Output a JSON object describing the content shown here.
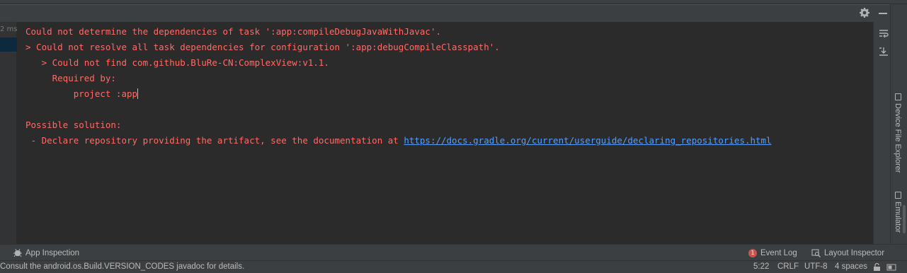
{
  "console": {
    "lines": [
      "Could not determine the dependencies of task ':app:compileDebugJavaWithJavac'.",
      "> Could not resolve all task dependencies for configuration ':app:debugCompileClasspath'.",
      "   > Could not find com.github.BluRe-CN:ComplexView:v1.1.",
      "     Required by:",
      "         project :app",
      "",
      "Possible solution:",
      " - Declare repository providing the artifact, see the documentation at "
    ],
    "link_text": "https://docs.gradle.org/current/userguide/declaring_repositories.html",
    "error_color": "#ff6b68",
    "link_color": "#589df6"
  },
  "left_gutter": {
    "timing_fragment": "2 ms"
  },
  "header": {
    "settings_icon": "gear-icon",
    "minimize_icon": "minimize-icon"
  },
  "console_tools": {
    "soft_wrap_icon": "soft-wrap-icon",
    "scroll_to_end_icon": "scroll-to-end-icon"
  },
  "right_sidebar": {
    "tabs": [
      {
        "label": "Device File Explorer",
        "icon": "device-file-explorer-icon"
      },
      {
        "label": "Emulator",
        "icon": "emulator-icon"
      }
    ]
  },
  "tool_windows": {
    "app_inspection": {
      "label": "App Inspection",
      "icon": "app-inspection-icon"
    },
    "event_log": {
      "label": "Event Log",
      "badge": "1",
      "icon": "event-log-icon"
    },
    "layout_inspector": {
      "label": "Layout Inspector",
      "icon": "layout-inspector-icon"
    }
  },
  "status_bar": {
    "message": "Consult the android.os.Build.VERSION_CODES javadoc for details.",
    "position": "5:22",
    "line_separator": "CRLF",
    "encoding": "UTF-8",
    "indent": "4 spaces",
    "lock_icon": "unlocked-icon",
    "colors": {
      "background": "#3c3f41",
      "text": "#bbbbbb"
    }
  }
}
